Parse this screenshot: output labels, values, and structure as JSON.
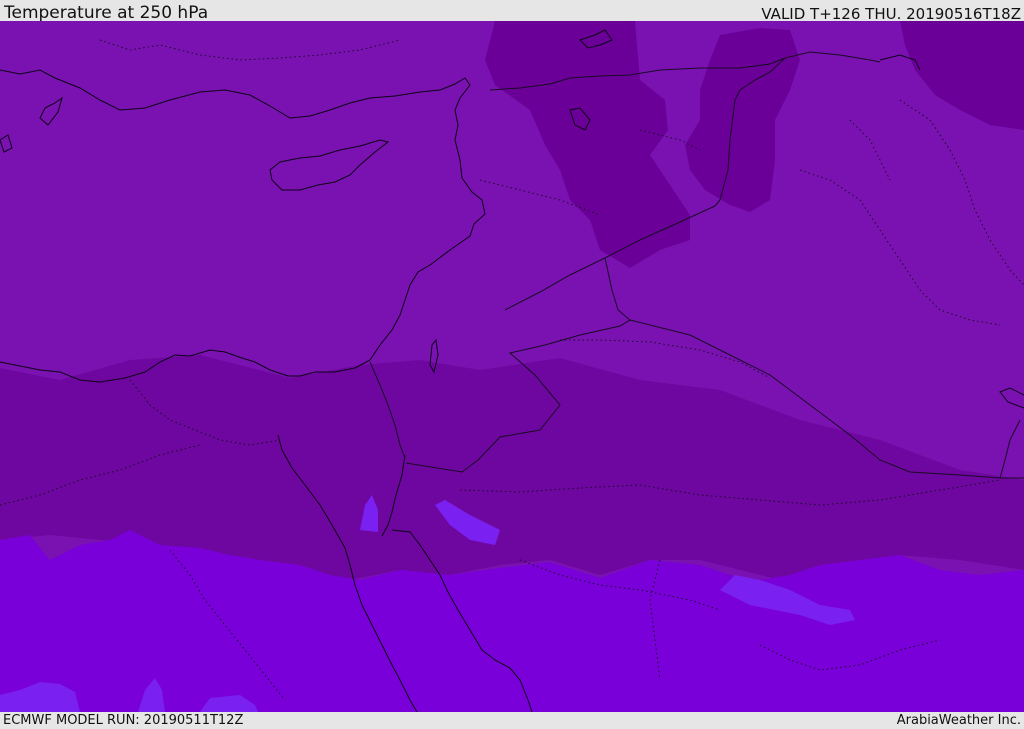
{
  "header": {
    "title": "Temperature at 250 hPa",
    "valid": "VALID T+126 THU. 20190516T18Z"
  },
  "footer": {
    "model_run": "ECMWF MODEL RUN: 20190511T12Z",
    "credit": "ArabiaWeather Inc."
  },
  "map": {
    "colors": {
      "band_base": "#7a12b1",
      "band_warm": "#7a00d9",
      "band_warmest": "#7a20f0",
      "band_cool": "#6e079f",
      "band_colder": "#6a0098",
      "coastline": "#0d0016",
      "borders": "#1a0a26"
    }
  }
}
